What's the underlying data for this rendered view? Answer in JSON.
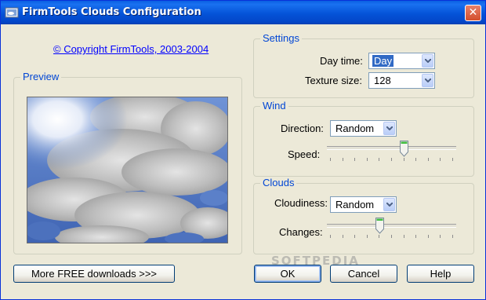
{
  "window": {
    "title": "FirmTools Clouds Configuration"
  },
  "copyright_link": "© Copyright FirmTools, 2003-2004",
  "preview": {
    "legend": "Preview"
  },
  "settings": {
    "legend": "Settings",
    "day_time_label": "Day time:",
    "day_time_value": "Day",
    "texture_size_label": "Texture size:",
    "texture_size_value": "128"
  },
  "wind": {
    "legend": "Wind",
    "direction_label": "Direction:",
    "direction_value": "Random",
    "speed_label": "Speed:",
    "speed_level": 0.6
  },
  "clouds": {
    "legend": "Clouds",
    "cloudiness_label": "Cloudiness:",
    "cloudiness_value": "Random",
    "changes_label": "Changes:",
    "changes_level": 0.4
  },
  "buttons": {
    "more_downloads": "More FREE downloads >>>",
    "ok": "OK",
    "cancel": "Cancel",
    "help": "Help"
  },
  "watermark": "SOFTPEDIA"
}
